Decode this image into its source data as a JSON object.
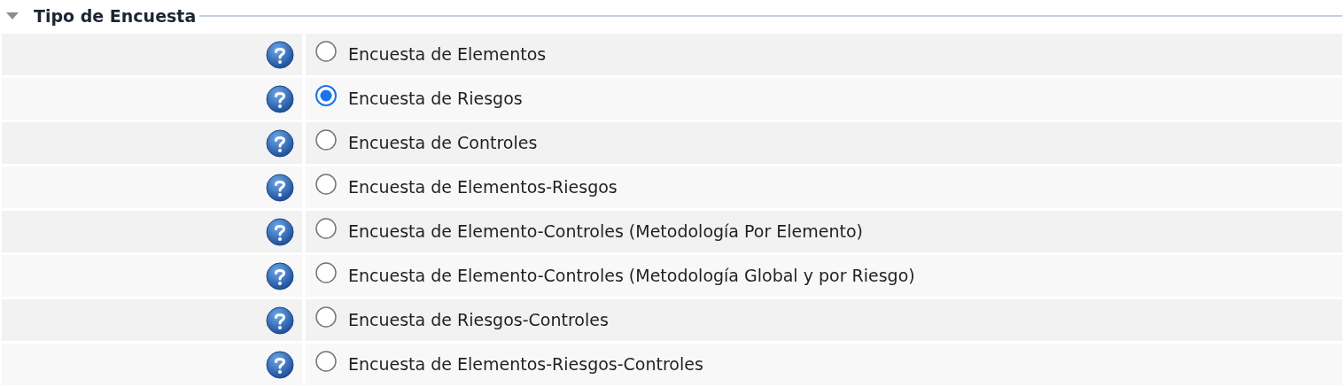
{
  "section": {
    "title": "Tipo de Encuesta",
    "expanded": true
  },
  "options": [
    {
      "label": "Encuesta de Elementos",
      "selected": false
    },
    {
      "label": "Encuesta de Riesgos",
      "selected": true
    },
    {
      "label": "Encuesta de Controles",
      "selected": false
    },
    {
      "label": "Encuesta de Elementos-Riesgos",
      "selected": false
    },
    {
      "label": "Encuesta de Elemento-Controles (Metodología Por Elemento)",
      "selected": false
    },
    {
      "label": "Encuesta de Elemento-Controles (Metodología Global y por Riesgo)",
      "selected": false
    },
    {
      "label": "Encuesta de Riesgos-Controles",
      "selected": false
    },
    {
      "label": "Encuesta de Elementos-Riesgos-Controles",
      "selected": false
    }
  ]
}
